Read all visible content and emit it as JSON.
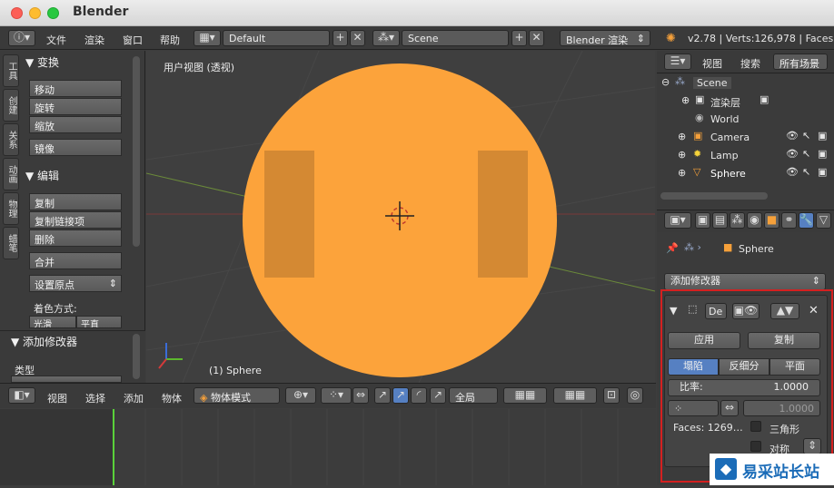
{
  "app": {
    "title": "Blender"
  },
  "topbar": {
    "menus": [
      "文件",
      "渲染",
      "窗口",
      "帮助"
    ],
    "screen_layout": "Default",
    "scene": "Scene",
    "render_engine": "Blender 渲染",
    "status": "v2.78 | Verts:126,978 | Faces:"
  },
  "tool_tabs": [
    "工具",
    "创建",
    "关系",
    "动画",
    "物理",
    "蜡笔"
  ],
  "toolshelf": {
    "transform": {
      "title": "▼ 变换",
      "buttons": [
        "移动",
        "旋转",
        "缩放",
        "镜像"
      ]
    },
    "edit": {
      "title": "▼ 编辑",
      "buttons": [
        "复制",
        "复制链接项",
        "删除",
        "合并"
      ],
      "origin": "设置原点",
      "shading_label": "着色方式:",
      "shading_buttons": [
        "光滑",
        "平直"
      ]
    },
    "add_modifier": {
      "title": "▼ 添加修改器",
      "type_label": "类型"
    }
  },
  "viewport": {
    "title": "用户视图 (透视)",
    "object_label": "(1) Sphere",
    "sphere_color": "#fca33b"
  },
  "viewport_header": {
    "menus": [
      "视图",
      "选择",
      "添加",
      "物体"
    ],
    "mode": "物体模式",
    "orientation": "全局"
  },
  "outliner": {
    "menus": [
      "视图",
      "搜索"
    ],
    "filter": "所有场景",
    "items": [
      "Scene",
      "渲染层",
      "World",
      "Camera",
      "Lamp",
      "Sphere"
    ]
  },
  "properties": {
    "breadcrumb_object": "Sphere",
    "add_modifier": "添加修改器",
    "modifier": {
      "name": "De",
      "apply": "应用",
      "copy": "复制",
      "tabs": [
        "塌陷",
        "反细分",
        "平面"
      ],
      "ratio_label": "比率:",
      "ratio_value": "1.0000",
      "symmetry_value": "1.0000",
      "faces": "Faces: 1269…",
      "triangulate": "三角形",
      "symmetry": "对称"
    }
  },
  "watermark": {
    "text": "易采站长站"
  }
}
